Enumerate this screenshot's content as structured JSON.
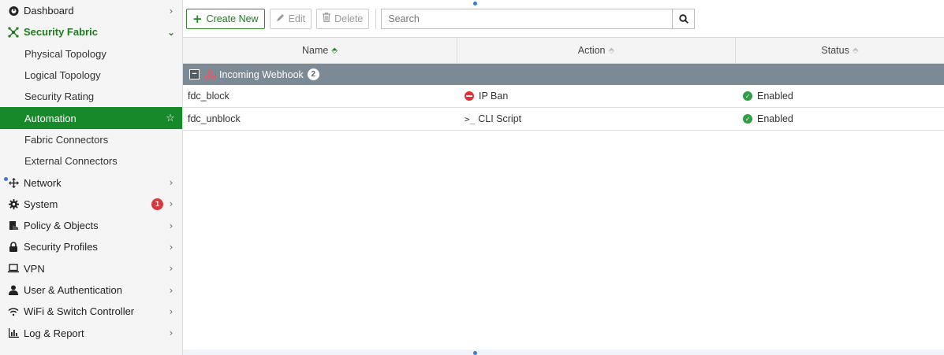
{
  "sidebar": {
    "items": [
      {
        "key": "dashboard",
        "label": "Dashboard",
        "icon": "dashboard-icon",
        "chevron": "›"
      },
      {
        "key": "security-fabric",
        "label": "Security Fabric",
        "icon": "security-fabric-icon",
        "chevron": "⌄"
      },
      {
        "key": "network",
        "label": "Network",
        "icon": "network-icon",
        "chevron": "›"
      },
      {
        "key": "system",
        "label": "System",
        "icon": "gear-icon",
        "chevron": "›",
        "badge": "1"
      },
      {
        "key": "policy-objects",
        "label": "Policy & Objects",
        "icon": "policy-icon",
        "chevron": "›"
      },
      {
        "key": "security-profiles",
        "label": "Security Profiles",
        "icon": "lock-icon",
        "chevron": "›"
      },
      {
        "key": "vpn",
        "label": "VPN",
        "icon": "laptop-icon",
        "chevron": "›"
      },
      {
        "key": "user-auth",
        "label": "User & Authentication",
        "icon": "user-icon",
        "chevron": "›"
      },
      {
        "key": "wifi-switch",
        "label": "WiFi & Switch Controller",
        "icon": "wifi-icon",
        "chevron": "›"
      },
      {
        "key": "log-report",
        "label": "Log & Report",
        "icon": "bar-chart-icon",
        "chevron": "›"
      }
    ],
    "sub_items": [
      {
        "label": "Physical Topology"
      },
      {
        "label": "Logical Topology"
      },
      {
        "label": "Security Rating"
      },
      {
        "label": "Automation",
        "active": true
      },
      {
        "label": "Fabric Connectors"
      },
      {
        "label": "External Connectors"
      }
    ],
    "favorite_icon": "☆"
  },
  "toolbar": {
    "create_label": "Create New",
    "edit_label": "Edit",
    "delete_label": "Delete",
    "search_placeholder": "Search"
  },
  "table": {
    "columns": [
      {
        "label": "Name",
        "sort": "asc"
      },
      {
        "label": "Action",
        "sort": "none"
      },
      {
        "label": "Status",
        "sort": "none"
      }
    ],
    "group": {
      "label": "Incoming Webhook",
      "count": "2",
      "collapse_symbol": "−"
    },
    "rows": [
      {
        "name": "fdc_block",
        "action": "IP Ban",
        "action_icon": "ban-icon",
        "status": "Enabled"
      },
      {
        "name": "fdc_unblock",
        "action": "CLI Script",
        "action_icon": "cli-icon",
        "status": "Enabled"
      }
    ]
  },
  "colors": {
    "accent_green": "#168a2a",
    "group_header": "#7c8a95",
    "status_enabled": "#2f9e44",
    "ban_red": "#e0313b",
    "badge_red": "#d9363e"
  }
}
